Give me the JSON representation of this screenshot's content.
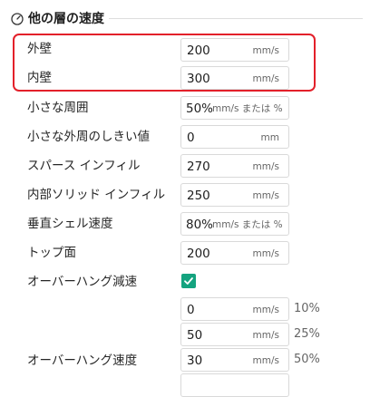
{
  "section": {
    "title": "他の層の速度",
    "icon": "speedometer-icon"
  },
  "rows": {
    "outer_wall": {
      "label": "外壁",
      "value": "200",
      "unit": "mm/s"
    },
    "inner_wall": {
      "label": "内壁",
      "value": "300",
      "unit": "mm/s"
    },
    "small_perimeter": {
      "label": "小さな周囲",
      "value": "50%",
      "unit": "mm/s または %"
    },
    "small_perimeter_threshold": {
      "label": "小さな外周のしきい値",
      "value": "0",
      "unit": "mm"
    },
    "sparse_infill": {
      "label": "スパース インフィル",
      "value": "270",
      "unit": "mm/s"
    },
    "internal_solid_infill": {
      "label": "内部ソリッド インフィル",
      "value": "250",
      "unit": "mm/s"
    },
    "vertical_shell_speed": {
      "label": "垂直シェル速度",
      "value": "80%",
      "unit": "mm/s または %"
    },
    "top_surface": {
      "label": "トップ面",
      "value": "200",
      "unit": "mm/s"
    },
    "overhang_slowdown": {
      "label": "オーバーハング減速",
      "checked": true
    },
    "overhang_speed": {
      "label": "オーバーハング速度",
      "levels": [
        {
          "value": "0",
          "unit": "mm/s",
          "percent": "10%"
        },
        {
          "value": "50",
          "unit": "mm/s",
          "percent": "25%"
        },
        {
          "value": "30",
          "unit": "mm/s",
          "percent": "50%"
        }
      ]
    }
  },
  "colors": {
    "highlight": "#e3202a",
    "checkbox": "#14a37f"
  }
}
